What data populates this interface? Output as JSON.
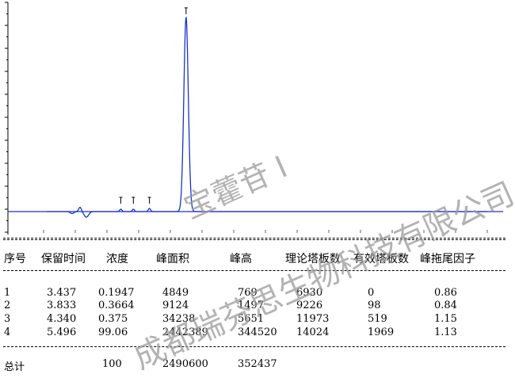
{
  "chart_data": {
    "type": "line",
    "title": "",
    "xlabel": "",
    "ylabel": "",
    "peak_times": [
      3.437,
      3.833,
      4.34,
      5.496
    ],
    "peak_heights": [
      769,
      1497,
      5651,
      344520
    ],
    "ylim": [
      0,
      350000
    ]
  },
  "colors": {
    "trace": "#1a33cc",
    "baseline": "#1a33cc"
  },
  "table": {
    "headers": [
      "序号",
      "保留时间",
      "浓度",
      "峰面积",
      "峰高",
      "理论塔板数",
      "有效塔板数",
      "峰拖尾因子"
    ],
    "rows": [
      [
        "1",
        "3.437",
        "0.1947",
        "4849",
        "769",
        "6930",
        "0",
        "0.86"
      ],
      [
        "2",
        "3.833",
        "0.3664",
        "9124",
        "1497",
        "9226",
        "98",
        "0.84"
      ],
      [
        "3",
        "4.340",
        "0.375",
        "34238",
        "5651",
        "11973",
        "519",
        "1.15"
      ],
      [
        "4",
        "5.496",
        "99.06",
        "2442389",
        "344520",
        "14024",
        "1969",
        "1.13"
      ]
    ],
    "total_label": "总计",
    "total_conc": "100",
    "total_area": "2490600",
    "total_height": "352437"
  },
  "watermark": {
    "compound": "宝藿苷 I",
    "company": "成都瑞芬思生物科技有限公司"
  }
}
